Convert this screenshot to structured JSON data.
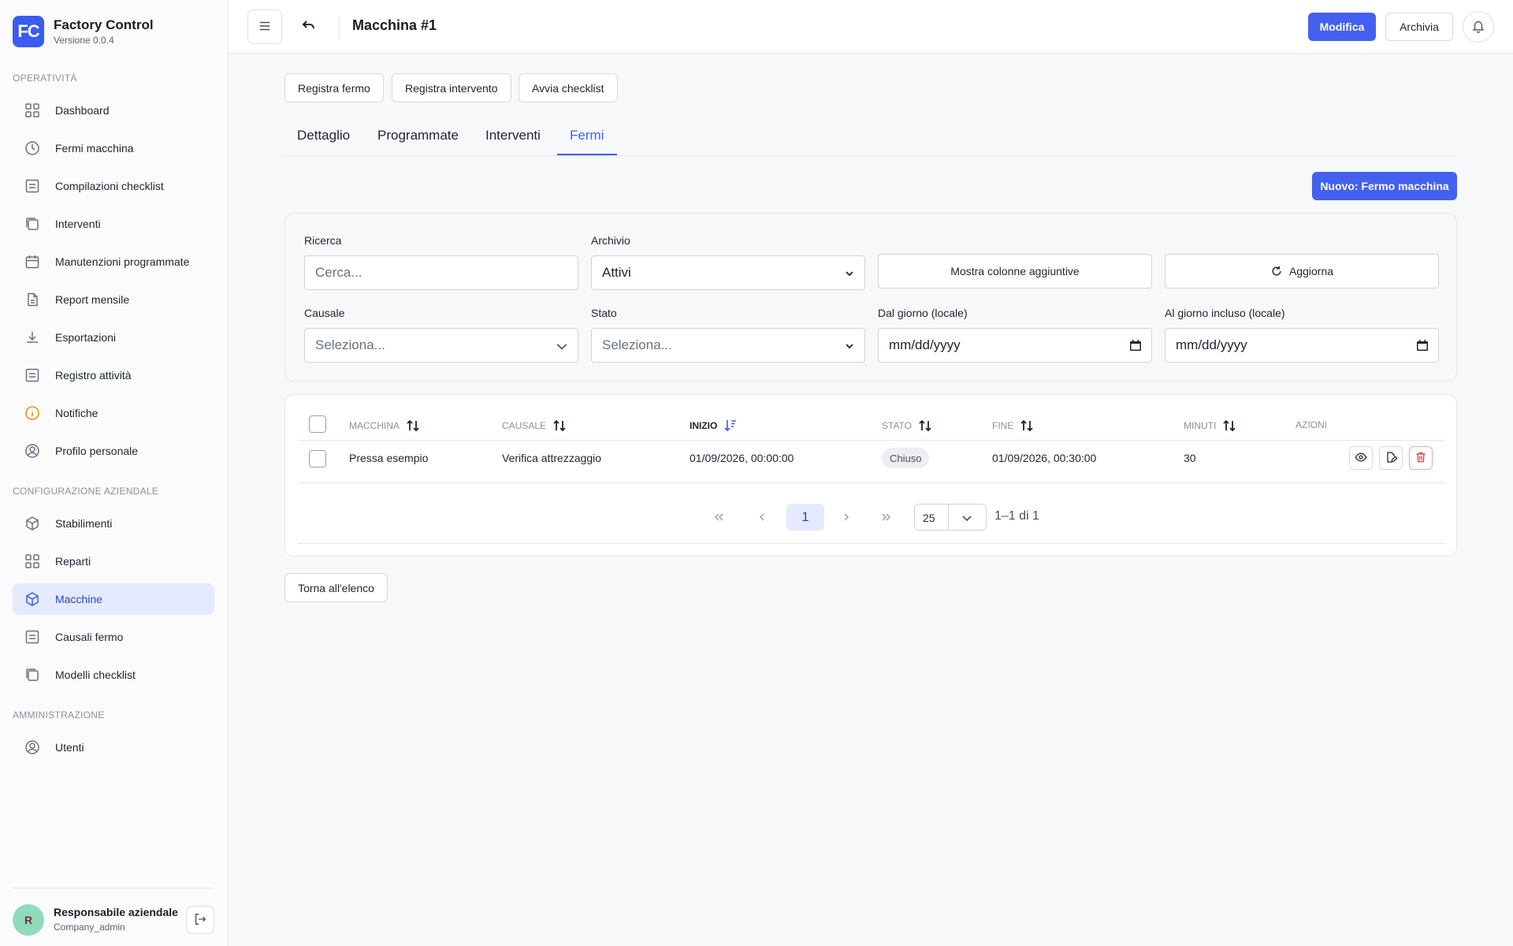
{
  "brand": {
    "logo_text": "FC",
    "title": "Factory Control",
    "version": "Versione 0.0.4"
  },
  "sidebar": {
    "sections": [
      {
        "title": "OPERATIVITÀ"
      },
      {
        "title": "CONFIGURAZIONE AZIENDALE"
      },
      {
        "title": "AMMINISTRAZIONE"
      }
    ],
    "items": [
      {
        "label": "Dashboard",
        "icon": "grid-icon"
      },
      {
        "label": "Fermi macchina",
        "icon": "clock-icon"
      },
      {
        "label": "Compilazioni checklist",
        "icon": "list-icon"
      },
      {
        "label": "Interventi",
        "icon": "copy-icon"
      },
      {
        "label": "Manutenzioni programmate",
        "icon": "calendar-icon"
      },
      {
        "label": "Report mensile",
        "icon": "report-icon"
      },
      {
        "label": "Esportazioni",
        "icon": "download-icon"
      },
      {
        "label": "Registro attività",
        "icon": "list-icon"
      },
      {
        "label": "Notifiche",
        "icon": "info-icon"
      },
      {
        "label": "Profilo personale",
        "icon": "user-icon"
      },
      {
        "label": "Stabilimenti",
        "icon": "box-icon"
      },
      {
        "label": "Reparti",
        "icon": "grid-icon"
      },
      {
        "label": "Macchine",
        "icon": "box-icon",
        "active": true
      },
      {
        "label": "Causali fermo",
        "icon": "list-icon"
      },
      {
        "label": "Modelli checklist",
        "icon": "copy-icon"
      },
      {
        "label": "Utenti",
        "icon": "user-icon"
      }
    ]
  },
  "user": {
    "initial": "R",
    "name": "Responsabile aziendale",
    "role": "Company_admin"
  },
  "topbar": {
    "title": "Macchina #1",
    "edit_label": "Modifica",
    "archive_label": "Archivia"
  },
  "actions": {
    "register_stop": "Registra fermo",
    "register_intervention": "Registra intervento",
    "start_checklist": "Avvia checklist"
  },
  "tabs": [
    {
      "label": "Dettaglio"
    },
    {
      "label": "Programmate"
    },
    {
      "label": "Interventi"
    },
    {
      "label": "Fermi",
      "active": true
    }
  ],
  "new_button": "Nuovo: Fermo macchina",
  "filters": {
    "search_label": "Ricerca",
    "search_placeholder": "Cerca...",
    "archive_label": "Archivio",
    "archive_value": "Attivi",
    "columns_button": "Mostra colonne aggiuntive",
    "refresh_button": "Aggiorna",
    "cause_label": "Causale",
    "cause_placeholder": "Seleziona...",
    "status_label": "Stato",
    "status_placeholder": "Seleziona...",
    "from_label": "Dal giorno (locale)",
    "from_placeholder": "mm/dd/yyyy",
    "to_label": "Al giorno incluso (locale)",
    "to_placeholder": "mm/dd/yyyy"
  },
  "table": {
    "columns": [
      "MACCHINA",
      "CAUSALE",
      "INIZIO",
      "STATO",
      "FINE",
      "MINUTI",
      "AZIONI"
    ],
    "sorted_column": "INIZIO",
    "rows": [
      {
        "machine": "Pressa esempio",
        "cause": "Verifica attrezzaggio",
        "start": "01/09/2026, 00:00:00",
        "status": "Chiuso",
        "end": "01/09/2026, 00:30:00",
        "minutes": "30"
      }
    ]
  },
  "pagination": {
    "current_page": "1",
    "per_page": "25",
    "range": "1–1 di 1"
  },
  "back_button": "Torna all'elenco",
  "colors": {
    "accent": "#4361ee",
    "active_bg": "#e4eaff",
    "danger": "#e03838"
  }
}
